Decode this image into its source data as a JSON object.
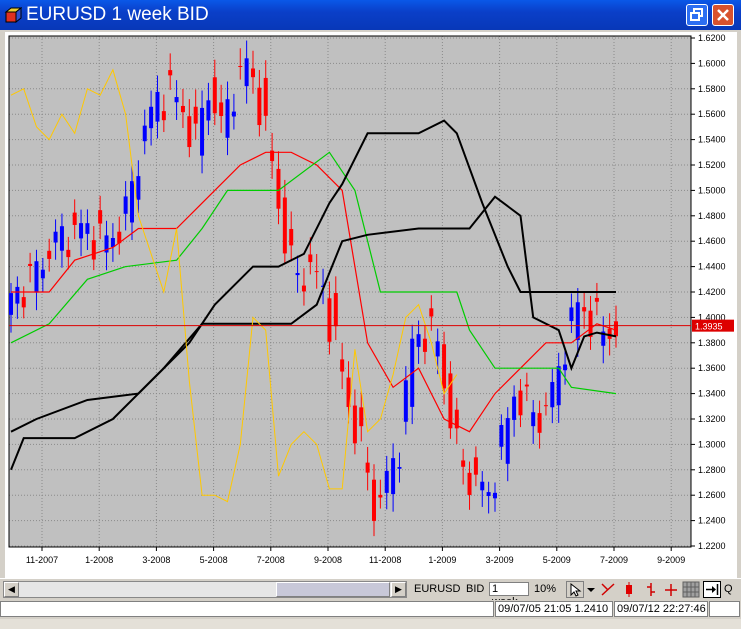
{
  "window": {
    "title": "EURUSD 1 week BID",
    "controls": [
      "restore-icon",
      "close-icon"
    ]
  },
  "chart_data": {
    "type": "line",
    "symbol": "EURUSD",
    "timeframe": "1 week",
    "ylim": [
      1.2,
      1.625
    ],
    "ytick_labels": [
      "1.6200",
      "1.6000",
      "1.5800",
      "1.5600",
      "1.5400",
      "1.5200",
      "1.5000",
      "1.4800",
      "1.4600",
      "1.4400",
      "1.4200",
      "1.4000",
      "1.3800",
      "1.3600",
      "1.3400",
      "1.3200",
      "1.3000",
      "1.2800",
      "1.2600",
      "1.2400",
      "1.2200"
    ],
    "xtick_labels": [
      "11-2007",
      "1-2008",
      "3-2008",
      "5-2008",
      "7-2008",
      "9-2008",
      "11-2008",
      "1-2009",
      "3-2009",
      "5-2009",
      "7-2009",
      "9-2009"
    ],
    "current_price": "1.3935",
    "grid": true,
    "colors": {
      "background": "#c0c0c0",
      "grid": "#8a8a8a",
      "bull_candle": "#0000ff",
      "bear_candle": "#ff0000",
      "tenkan": "#ff0000",
      "kijun": "#00cc00",
      "senkou": "#000000",
      "chikou": "#ffc800",
      "price_line": "#dd0000"
    },
    "series": [
      {
        "values": [
          [
            0,
            1.42
          ],
          [
            6,
            1.42
          ],
          [
            10,
            1.445
          ],
          [
            16,
            1.455
          ],
          [
            20,
            1.47
          ],
          [
            26,
            1.47
          ],
          [
            30,
            1.49
          ],
          [
            36,
            1.52
          ],
          [
            40,
            1.53
          ],
          [
            44,
            1.53
          ],
          [
            48,
            1.52
          ],
          [
            52,
            1.5
          ],
          [
            56,
            1.38
          ],
          [
            60,
            1.345
          ],
          [
            64,
            1.36
          ],
          [
            68,
            1.32
          ],
          [
            72,
            1.31
          ],
          [
            76,
            1.34
          ],
          [
            80,
            1.36
          ],
          [
            84,
            1.38
          ],
          [
            88,
            1.38
          ],
          [
            92,
            1.395
          ],
          [
            95,
            1.39
          ]
        ]
      },
      {
        "values": [
          [
            0,
            1.38
          ],
          [
            6,
            1.395
          ],
          [
            12,
            1.43
          ],
          [
            18,
            1.44
          ],
          [
            26,
            1.445
          ],
          [
            30,
            1.47
          ],
          [
            34,
            1.5
          ],
          [
            42,
            1.5
          ],
          [
            50,
            1.53
          ],
          [
            54,
            1.5
          ],
          [
            58,
            1.42
          ],
          [
            62,
            1.42
          ],
          [
            70,
            1.42
          ],
          [
            72,
            1.39
          ],
          [
            76,
            1.36
          ],
          [
            80,
            1.36
          ],
          [
            86,
            1.36
          ],
          [
            88,
            1.345
          ],
          [
            95,
            1.34
          ]
        ]
      },
      {
        "values": [
          [
            0,
            1.31
          ],
          [
            4,
            1.32
          ],
          [
            12,
            1.335
          ],
          [
            20,
            1.34
          ],
          [
            28,
            1.38
          ],
          [
            32,
            1.41
          ],
          [
            38,
            1.44
          ],
          [
            42,
            1.44
          ],
          [
            46,
            1.45
          ],
          [
            50,
            1.49
          ],
          [
            52,
            1.505
          ],
          [
            56,
            1.545
          ],
          [
            64,
            1.545
          ],
          [
            68,
            1.555
          ],
          [
            70,
            1.545
          ],
          [
            74,
            1.49
          ],
          [
            78,
            1.44
          ],
          [
            80,
            1.42
          ],
          [
            95,
            1.42
          ]
        ]
      },
      {
        "values": [
          [
            0,
            1.28
          ],
          [
            2,
            1.305
          ],
          [
            10,
            1.305
          ],
          [
            16,
            1.32
          ],
          [
            24,
            1.36
          ],
          [
            30,
            1.395
          ],
          [
            38,
            1.395
          ],
          [
            44,
            1.395
          ],
          [
            48,
            1.41
          ],
          [
            50,
            1.435
          ],
          [
            52,
            1.46
          ],
          [
            56,
            1.465
          ],
          [
            64,
            1.47
          ],
          [
            72,
            1.47
          ],
          [
            76,
            1.495
          ],
          [
            80,
            1.48
          ],
          [
            82,
            1.4
          ],
          [
            86,
            1.39
          ],
          [
            88,
            1.36
          ],
          [
            90,
            1.385
          ],
          [
            92,
            1.388
          ],
          [
            95,
            1.385
          ]
        ]
      },
      {
        "values": [
          [
            0,
            1.575
          ],
          [
            2,
            1.58
          ],
          [
            4,
            1.55
          ],
          [
            6,
            1.54
          ],
          [
            8,
            1.56
          ],
          [
            10,
            1.545
          ],
          [
            12,
            1.58
          ],
          [
            14,
            1.575
          ],
          [
            16,
            1.595
          ],
          [
            18,
            1.56
          ],
          [
            20,
            1.48
          ],
          [
            24,
            1.42
          ],
          [
            26,
            1.47
          ],
          [
            28,
            1.35
          ],
          [
            30,
            1.26
          ],
          [
            32,
            1.26
          ],
          [
            34,
            1.255
          ],
          [
            36,
            1.3
          ],
          [
            38,
            1.4
          ],
          [
            40,
            1.39
          ],
          [
            42,
            1.275
          ],
          [
            44,
            1.3
          ],
          [
            46,
            1.31
          ],
          [
            48,
            1.3
          ],
          [
            50,
            1.265
          ],
          [
            52,
            1.265
          ],
          [
            54,
            1.375
          ],
          [
            56,
            1.31
          ],
          [
            58,
            1.32
          ],
          [
            60,
            1.355
          ],
          [
            62,
            1.4
          ],
          [
            64,
            1.41
          ],
          [
            66,
            1.38
          ],
          [
            68,
            1.34
          ],
          [
            70,
            1.355
          ]
        ]
      }
    ]
  },
  "toolbar": {
    "symbol": "EURUSD",
    "side": "BID",
    "period": "1 week",
    "zoom": "10%",
    "right_label": "Q",
    "icons": [
      "left-arrow-icon",
      "right-arrow-icon",
      "cursor-icon",
      "dropdown-arrow-icon",
      "crosshair-icon",
      "candle-icon",
      "bar-icon",
      "line-icon",
      "grid-icon",
      "exit-icon"
    ]
  },
  "status": {
    "blank": "",
    "cursor_info": "09/07/05 21:05 1.2410",
    "server_time": "09/07/12 22:27:46"
  }
}
